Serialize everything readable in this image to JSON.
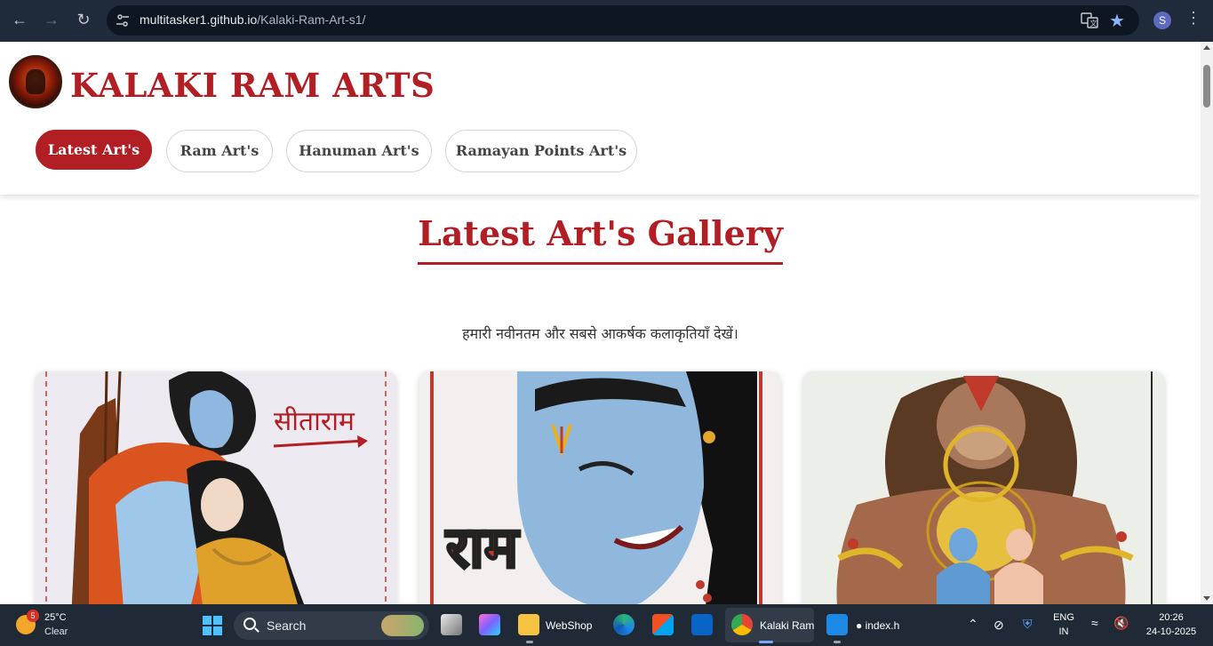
{
  "browser": {
    "url_host": "multitasker1.github.io",
    "url_path": "/Kalaki-Ram-Art-s1/",
    "profile_initial": "S"
  },
  "site": {
    "brand": "KALAKI RAM ARTS",
    "nav": [
      {
        "label": "Latest Art's",
        "active": true
      },
      {
        "label": "Ram Art's",
        "active": false
      },
      {
        "label": "Hanuman Art's",
        "active": false
      },
      {
        "label": "Ramayan Points Art's",
        "active": false
      }
    ],
    "gallery_title": "Latest Art's Gallery",
    "subtitle": "हमारी नवीनतम और सबसे आकर्षक कलाकृतियाँ देखें।",
    "cards": [
      {
        "image": "Sita Ram drawing",
        "caption_in_art": "सीताराम"
      },
      {
        "image": "Ram portrait drawing",
        "caption_in_art": "राम"
      },
      {
        "image": "Hanuman with Ram and Sita drawing",
        "caption_in_art": ""
      }
    ],
    "accent_color": "#b11e24"
  },
  "taskbar": {
    "weather_temp": "25°C",
    "weather_cond": "Clear",
    "notification_count": "5",
    "search_label": "Search",
    "apps": [
      "WebShop",
      "Kalaki Ram",
      "● index.h"
    ],
    "lang_top": "ENG",
    "lang_bottom": "IN",
    "time": "20:26",
    "date": "24-10-2025"
  }
}
